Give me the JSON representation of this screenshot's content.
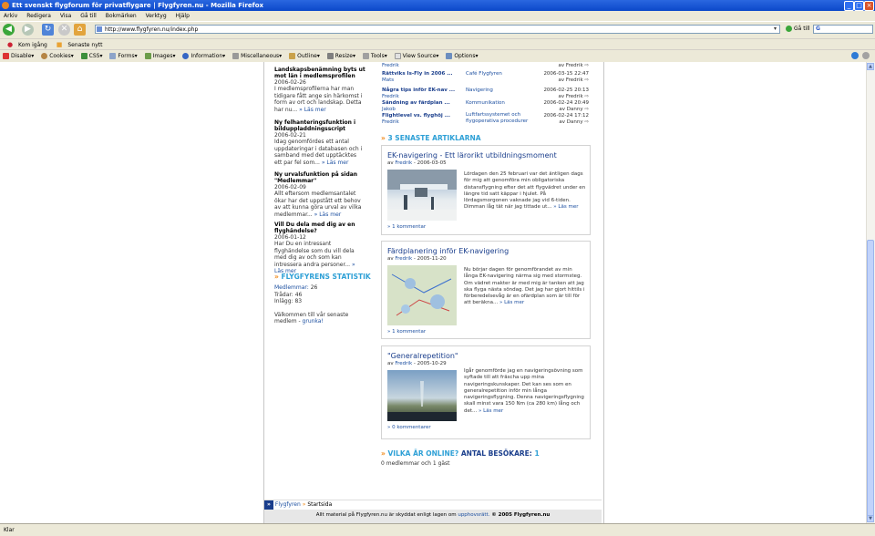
{
  "window": {
    "title": "Ett svenskt flygforum för privatflygare | Flygfyren.nu - Mozilla Firefox"
  },
  "menu": [
    "Arkiv",
    "Redigera",
    "Visa",
    "Gå till",
    "Bokmärken",
    "Verktyg",
    "Hjälp"
  ],
  "nav": {
    "url": "http://www.flygfyren.nu/index.php",
    "go_label": "Gå till"
  },
  "bookmarks": [
    "Kom igång",
    "Senaste nytt"
  ],
  "devbar": [
    "Disable▾",
    "Cookies▾",
    "CSS▾",
    "Forms▾",
    "Images▾",
    "Information▾",
    "Miscellaneous▾",
    "Outline▾",
    "Resize▾",
    "Tools▾",
    "View Source▾",
    "Options▾"
  ],
  "sidebar": {
    "news": [
      {
        "title": "Landskapsbenämning byts ut mot län i medlemsprofilen",
        "date": "2006-02-26",
        "text": "I medlemsprofilerna har man tidigare fått ange sin härkomst i form av ort och landskap. Detta har nu...",
        "more": "» Läs mer"
      },
      {
        "title": "Ny felhanteringsfunktion i bilduppladdningsscript",
        "date": "2006-02-21",
        "text": "Idag genomfördes ett antal uppdateringar i databasen och i samband med det upptäcktes ett par fel som...",
        "more": "» Läs mer"
      },
      {
        "title": "Ny urvalsfunktion på sidan \"Medlemmar\"",
        "date": "2006-02-09",
        "text": "Allt eftersom medlemsantalet ökar har det uppstått ett behov av att kunna göra urval av vilka medlemmar...",
        "more": "» Läs mer"
      },
      {
        "title": "Vill Du dela med dig av en flyghändelse?",
        "date": "2006-01-12",
        "text": "Har Du en intressant flyghändelse som du vill dela med dig av och som kan intressera andra personer...",
        "more": "» Läs mer"
      }
    ],
    "stats": {
      "heading": "FLYGFYRENS STATISTIK",
      "members_label": "Medlemmar:",
      "members": "26",
      "threads_label": "Trådar:",
      "threads": "46",
      "posts_label": "Inlägg:",
      "posts": "83",
      "welcome": "Välkommen till vår senaste medlem -",
      "newest": "grunka!"
    }
  },
  "posts": [
    {
      "title": "",
      "author": "Fredrik",
      "forum": "",
      "date": "",
      "by": "av Fredrik"
    },
    {
      "title": "Rättviks Is-Fly in 2006 ...",
      "author": "Mats",
      "forum": "Café Flygfyren",
      "date": "2006-03-15 22:47",
      "by": "av Fredrik"
    },
    {
      "title": "Några tips inför EK-nav ...",
      "author": "Fredrik",
      "forum": "Navigering",
      "date": "2006-02-25 20:13",
      "by": "av Fredrik"
    },
    {
      "title": "Sändning av färdplan ...",
      "author": "Jakob",
      "forum": "Kommunikation",
      "date": "2006-02-24 20:49",
      "by": "av Danny"
    },
    {
      "title": "Flightlevel vs. flyghöj ...",
      "author": "Fredrik",
      "forum": "Luftfartssystemet och flygoperativa procedurer",
      "date": "2006-02-24 17:12",
      "by": "av Danny"
    }
  ],
  "articles": {
    "heading": "3 SENASTE ARTIKLARNA",
    "items": [
      {
        "title": "EK-navigering - Ett lärorikt utbildningsmoment",
        "meta_prefix": "av",
        "author": "Fredrik",
        "date": "- 2006-03-05",
        "text": "Lördagen den 25 februari var det äntligen dags för mig att genomföra min obligatoriska distansflygning efter det att flygvädret under en längre tid satt käppar i hjulet. På lördagsmorgonen vaknade jag vid 6-tiden. Dimman låg tät när jag tittade ut...",
        "more": "» Läs mer",
        "comments": "» 1 kommentar"
      },
      {
        "title": "Färdplanering inför EK-navigering",
        "meta_prefix": "av",
        "author": "Fredrik",
        "date": "- 2005-11-20",
        "text": "Nu börjar dagen för genomförandet av min långa EK-navigering närma sig med stormsteg. Om vädret makter är med mig är tanken att jag ska flyga nästa söndag. Det jag har gjort hittils i förberedelsevåg är en ofärdplan som är till för att beräkna...",
        "more": "» Läs mer",
        "comments": "» 1 kommentar"
      },
      {
        "title": "\"Generalrepetition\"",
        "meta_prefix": "av",
        "author": "Fredrik",
        "date": "- 2005-10-29",
        "text": "Igår genomförde jag en navigeringsövning som syftade till att fräscha upp mina navigeringskunskaper. Det kan ses som en generalrepetition inför min långa navigeringsflygning. Denna navigeringsflygning skall minst vara 150 Nm (ca 280 km) lång och det...",
        "more": "» Läs mer",
        "comments": "» 0 kommentarer"
      }
    ]
  },
  "online": {
    "heading": "VILKA ÄR ONLINE?",
    "visitors_label": "ANTAL BESÖKARE:",
    "visitors": "1",
    "text": "0 medlemmar och 1 gäst"
  },
  "breadcrumb": {
    "icon": "»",
    "home": "Flygfyren",
    "sep": "»",
    "current": "Startsida"
  },
  "footer": {
    "text": "Allt material på Flygfyren.nu är skyddat enligt lagen om",
    "link": "upphovsrätt.",
    "copy": "© 2005 Flygfyren.nu"
  },
  "status": {
    "text": "Klar"
  }
}
